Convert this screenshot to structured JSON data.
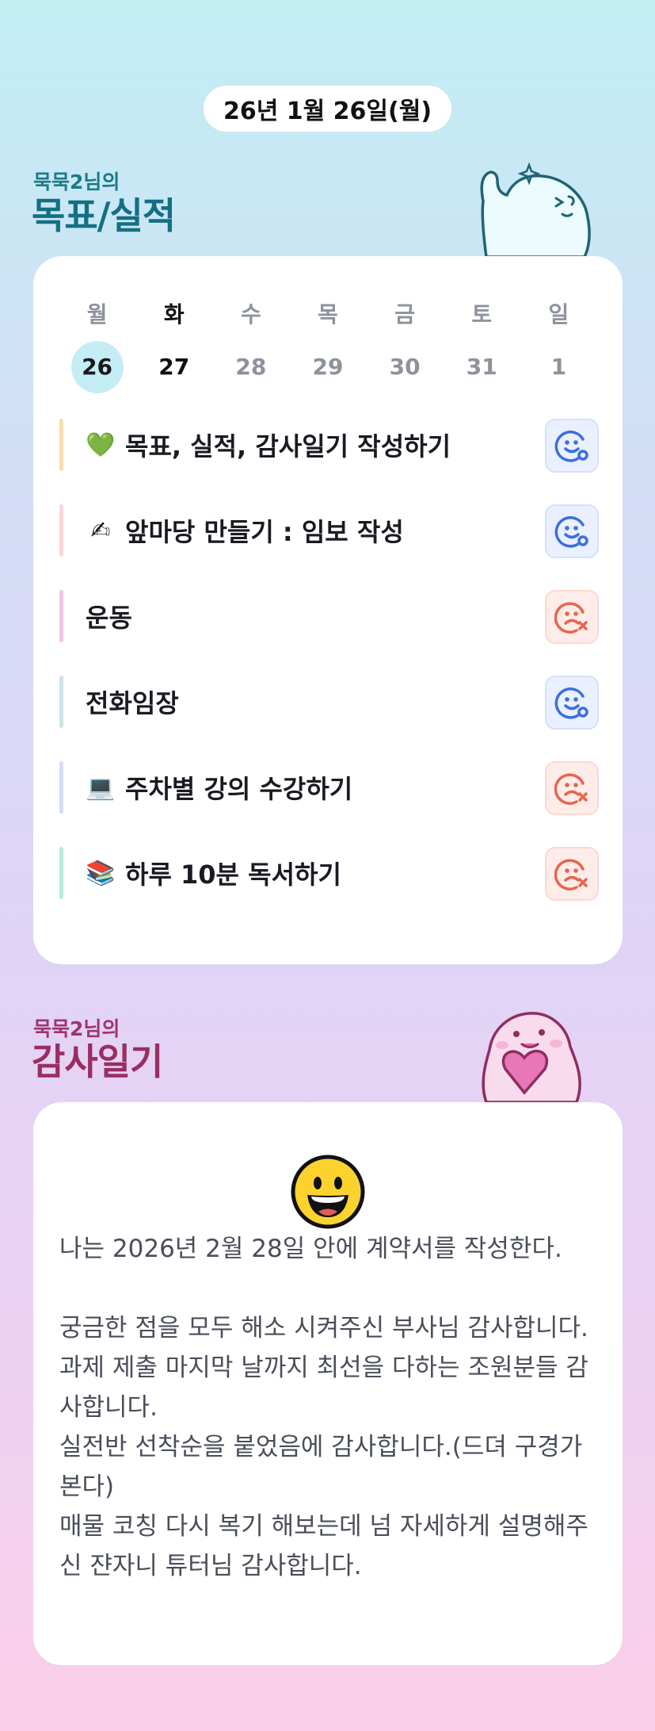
{
  "date_label": "26년 1월 26일(월)",
  "goals_section": {
    "subtitle": "묵묵2님의",
    "title": "목표/실적"
  },
  "week": {
    "days": [
      "월",
      "화",
      "수",
      "목",
      "금",
      "토",
      "일"
    ],
    "dates": [
      "26",
      "27",
      "28",
      "29",
      "30",
      "31",
      "1"
    ]
  },
  "goals": [
    {
      "emoji": "💚",
      "emoji_name": "green-heart-icon",
      "text": "목표, 실적, 감사일기 작성하기",
      "bar_color": "#fbdcb0",
      "status": "done",
      "status_icon": "smile-check-icon"
    },
    {
      "emoji": "✍",
      "emoji_name": "writing-hand-icon",
      "text": "앞마당 만들기 : 임보 작성",
      "bar_color": "#fbd5d5",
      "status": "done",
      "status_icon": "smile-check-icon"
    },
    {
      "emoji": "",
      "emoji_name": "",
      "text": "운동",
      "bar_color": "#fac3e1",
      "status": "missed",
      "status_icon": "sad-x-icon"
    },
    {
      "emoji": "",
      "emoji_name": "",
      "text": "전화임장",
      "bar_color": "#cde3e6",
      "status": "done",
      "status_icon": "smile-check-icon"
    },
    {
      "emoji": "💻",
      "emoji_name": "laptop-icon",
      "text": "주차별 강의 수강하기",
      "bar_color": "#d4dbf7",
      "status": "missed",
      "status_icon": "sad-x-icon"
    },
    {
      "emoji": "📚",
      "emoji_name": "books-icon",
      "text": "하루 10분 독서하기",
      "bar_color": "#b5eed6",
      "status": "missed",
      "status_icon": "sad-x-icon"
    }
  ],
  "gratitude_section": {
    "subtitle": "묵묵2님의",
    "title": "감사일기"
  },
  "gratitude": {
    "mood_icon": "grinning-face-icon",
    "text": "나는 2026년 2월 28일 안에 계약서를 작성한다.\n\n궁금한 점을 모두 해소 시켜주신 부사님 감사합니다.\n과제 제출 마지막 날까지 최선을 다하는 조원분들 감사합니다.\n실전반 선착순을 붙었음에 감사합니다.(드뎌 구경가본다)\n매물 코칭 다시 복기 해보는데 넘 자세하게 설명해주신 쟌자니 튜터님 감사합니다."
  },
  "colors": {
    "ok_icon": "#3b6fe0",
    "bad_icon": "#e8654e",
    "goals_title": "#137082",
    "gratitude_title": "#9a2d63"
  }
}
